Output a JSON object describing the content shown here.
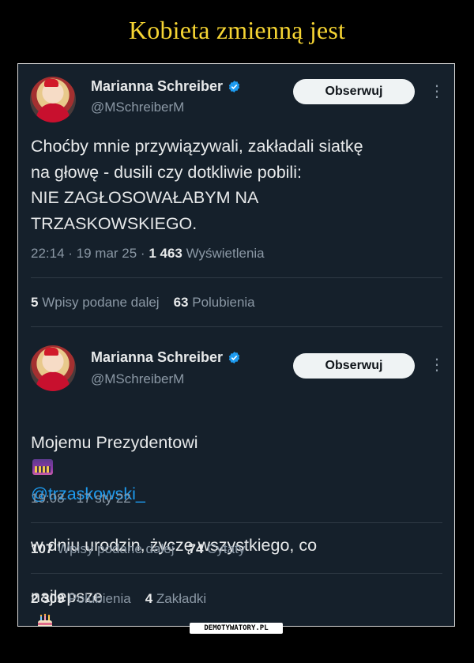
{
  "page": {
    "title": "Kobieta zmienną jest",
    "watermark": "DEMOTYWATORY.PL"
  },
  "tweets": [
    {
      "author": {
        "name": "Marianna Schreiber",
        "handle": "@MSchreiberM",
        "verified": true
      },
      "follow_label": "Obserwuj",
      "text": "Choćby mnie przywiązywali, zakładali siatkę\nna głowę - dusili czy dotkliwie pobili:\nNIE ZAGŁOSOWAŁABYM NA\nTRZASKOWSKIEGO.",
      "time": "22:14",
      "date": "19 mar 25",
      "views": "1 463",
      "views_label": "Wyświetlenia",
      "reposts": "5",
      "reposts_label": "Wpisy podane dalej",
      "likes": "63",
      "likes_label": "Polubienia"
    },
    {
      "author": {
        "name": "Marianna Schreiber",
        "handle": "@MSchreiberM",
        "verified": true
      },
      "follow_label": "Obserwuj",
      "text_before": "Mojemu Prezydentowi",
      "mention": "@trzaskowski_",
      "text_line2": "w dniu urodzin, życzę wszystkiego, co",
      "text_line3": "najlepsze",
      "emoji": [
        "city-dusk-emoji",
        "birthday-cake-emoji"
      ],
      "time": "19:08",
      "date": "17 sty 22",
      "reposts": "107",
      "reposts_label": "Wpisy podane dalej",
      "quotes": "74",
      "quotes_label": "Cytaty",
      "likes": "2 309",
      "likes_label": "Polubienia",
      "bookmarks": "4",
      "bookmarks_label": "Zakładki"
    }
  ],
  "colors": {
    "background": "#15202b",
    "title": "#f6d533",
    "link": "#1d9bf0",
    "verified": "#1d9bf0"
  }
}
